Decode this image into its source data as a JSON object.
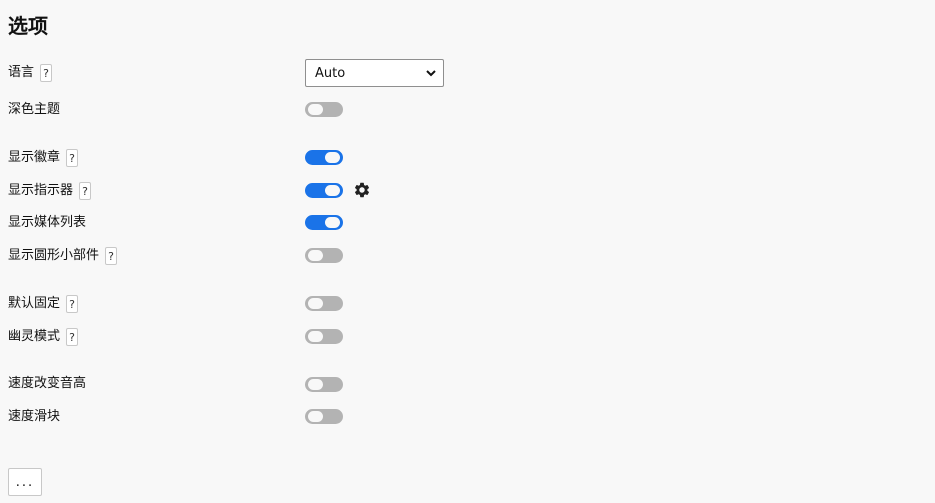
{
  "title": "选项",
  "help_label": "?",
  "language": {
    "label": "语言",
    "value": "Auto"
  },
  "options": [
    {
      "label": "深色主题",
      "on": false
    },
    {
      "label": "显示徽章",
      "on": true
    },
    {
      "label": "显示指示器",
      "on": true
    },
    {
      "label": "显示媒体列表",
      "on": true
    },
    {
      "label": "显示圆形小部件",
      "on": false
    },
    {
      "label": "默认固定",
      "on": false
    },
    {
      "label": "幽灵模式",
      "on": false
    },
    {
      "label": "速度改变音高",
      "on": false
    },
    {
      "label": "速度滑块",
      "on": false
    }
  ],
  "icons": {
    "help": "help-icon",
    "settings": "gear-icon",
    "dropdown": "chevron-down-icon"
  },
  "colors": {
    "toggle_on": "#1a73e8",
    "toggle_off": "#b3b3b3"
  },
  "more_label": "..."
}
